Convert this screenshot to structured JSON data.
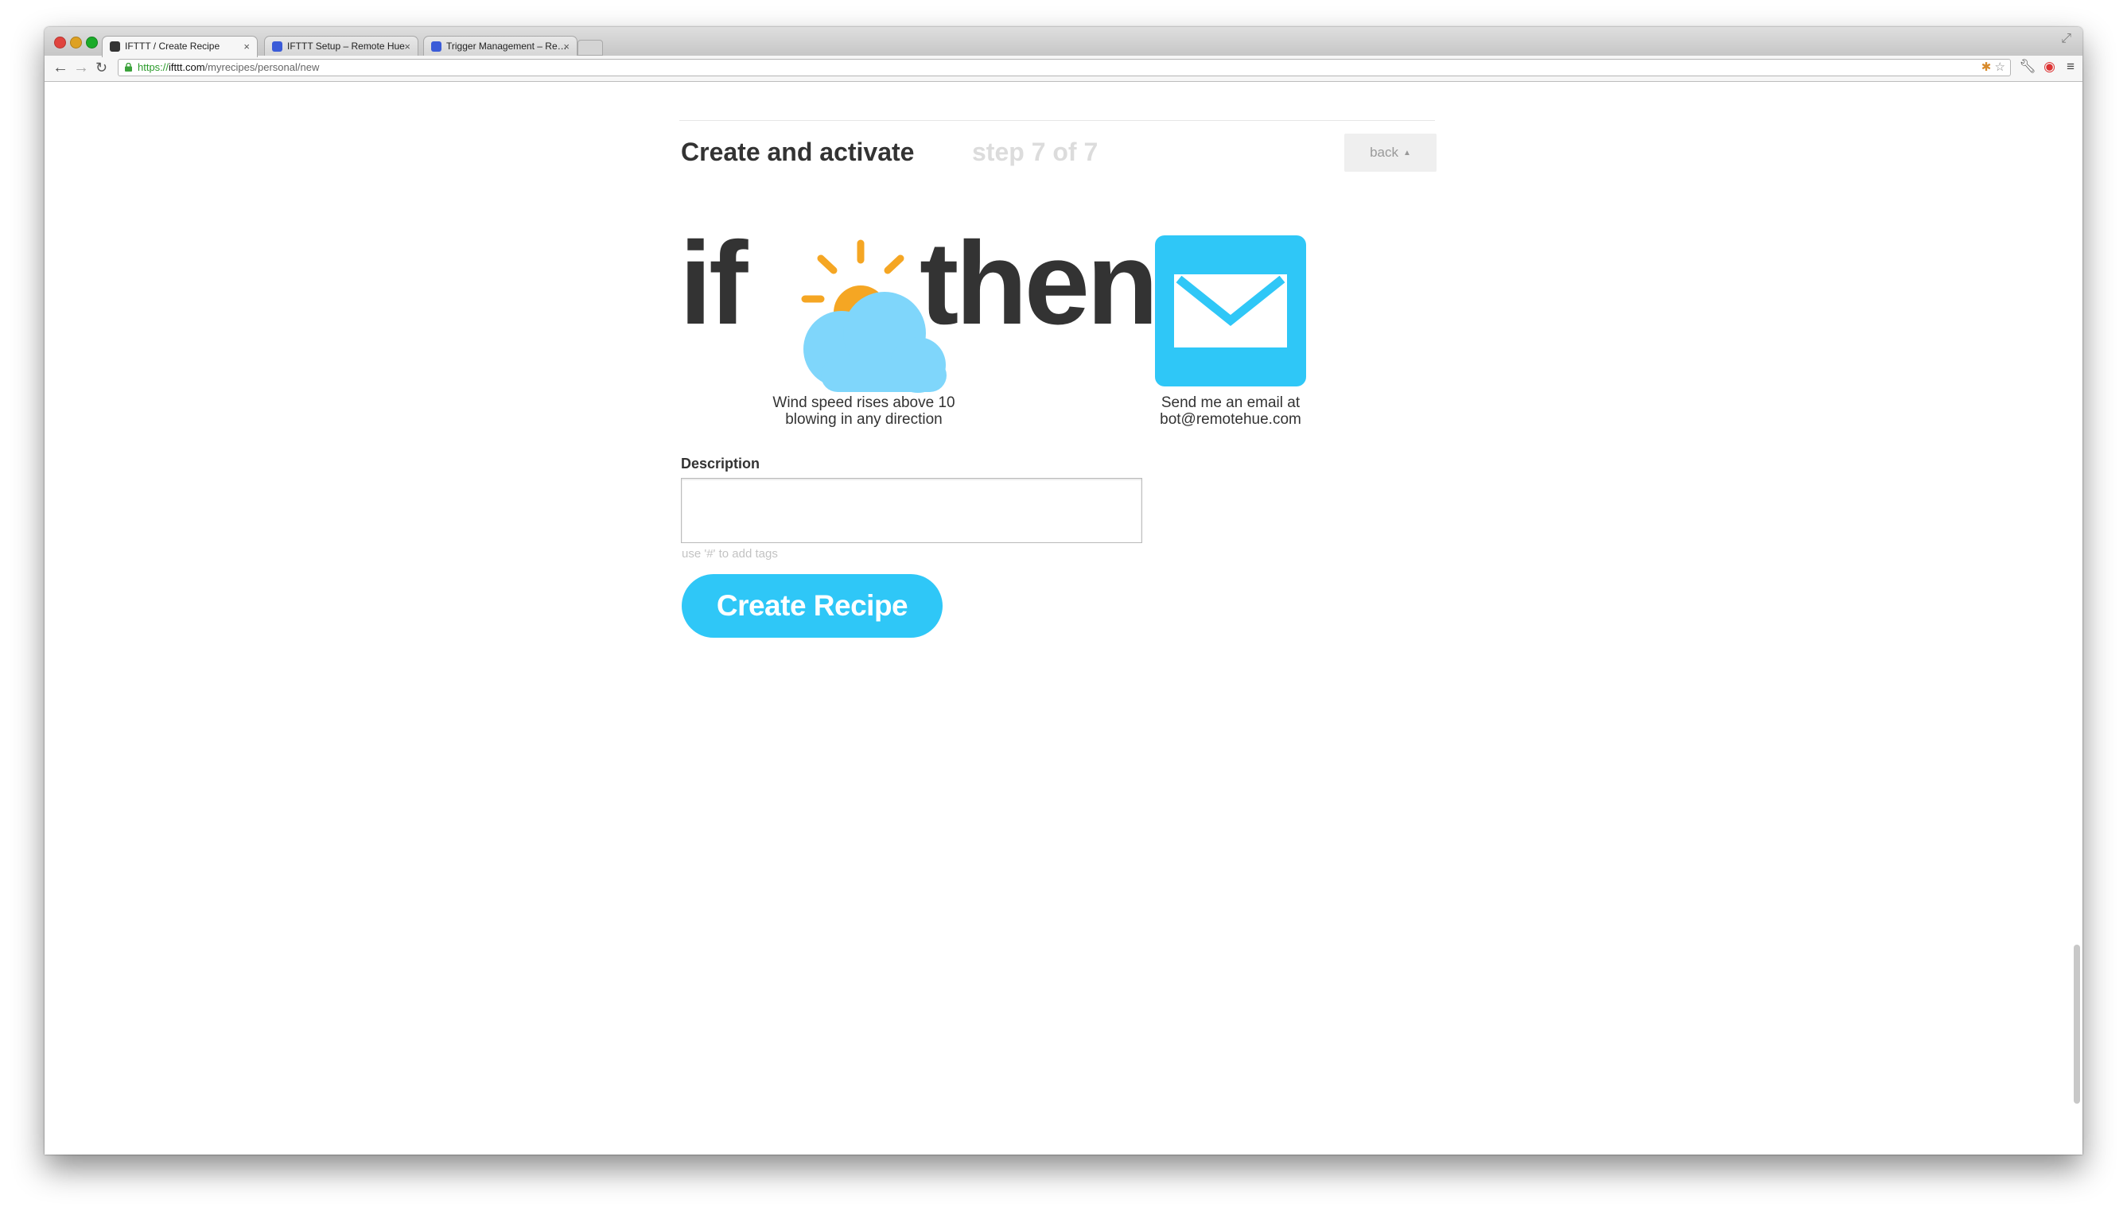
{
  "browser": {
    "tabs": [
      {
        "title": "IFTTT / Create Recipe",
        "active": true,
        "favicon_color": "#333333"
      },
      {
        "title": "IFTTT Setup – Remote Hue",
        "active": false,
        "favicon_color": "#3a5bd8"
      },
      {
        "title": "Trigger Management – Re…",
        "active": false,
        "favicon_color": "#3a5bd8"
      }
    ],
    "close_glyph": "×",
    "url": {
      "protocol": "https://",
      "host": "ifttt.com",
      "path": "/myrecipes/personal/new"
    },
    "icons": [
      "back-arrow-icon",
      "forward-arrow-icon",
      "reload-icon",
      "lock-icon",
      "extension-icon",
      "star-icon",
      "wrench-icon",
      "opera-icon",
      "menu-icon"
    ]
  },
  "header": {
    "title": "Create and activate",
    "step": "step 7 of 7",
    "back_label": "back"
  },
  "recipe": {
    "if_word": "if",
    "then_word": "then",
    "trigger_icon": "weather-icon",
    "action_icon": "email-icon",
    "trigger_line1": "Wind speed rises above 10",
    "trigger_line2": "blowing in any direction",
    "action_line1": "Send me an email at",
    "action_line2": "bot@remotehue.com"
  },
  "form": {
    "description_label": "Description",
    "description_value": "",
    "hint": "use '#' to add tags",
    "create_label": "Create Recipe"
  },
  "colors": {
    "accent": "#2fc7f7",
    "sun": "#f5a623",
    "cloud": "#7fd6fb",
    "text": "#333333"
  }
}
